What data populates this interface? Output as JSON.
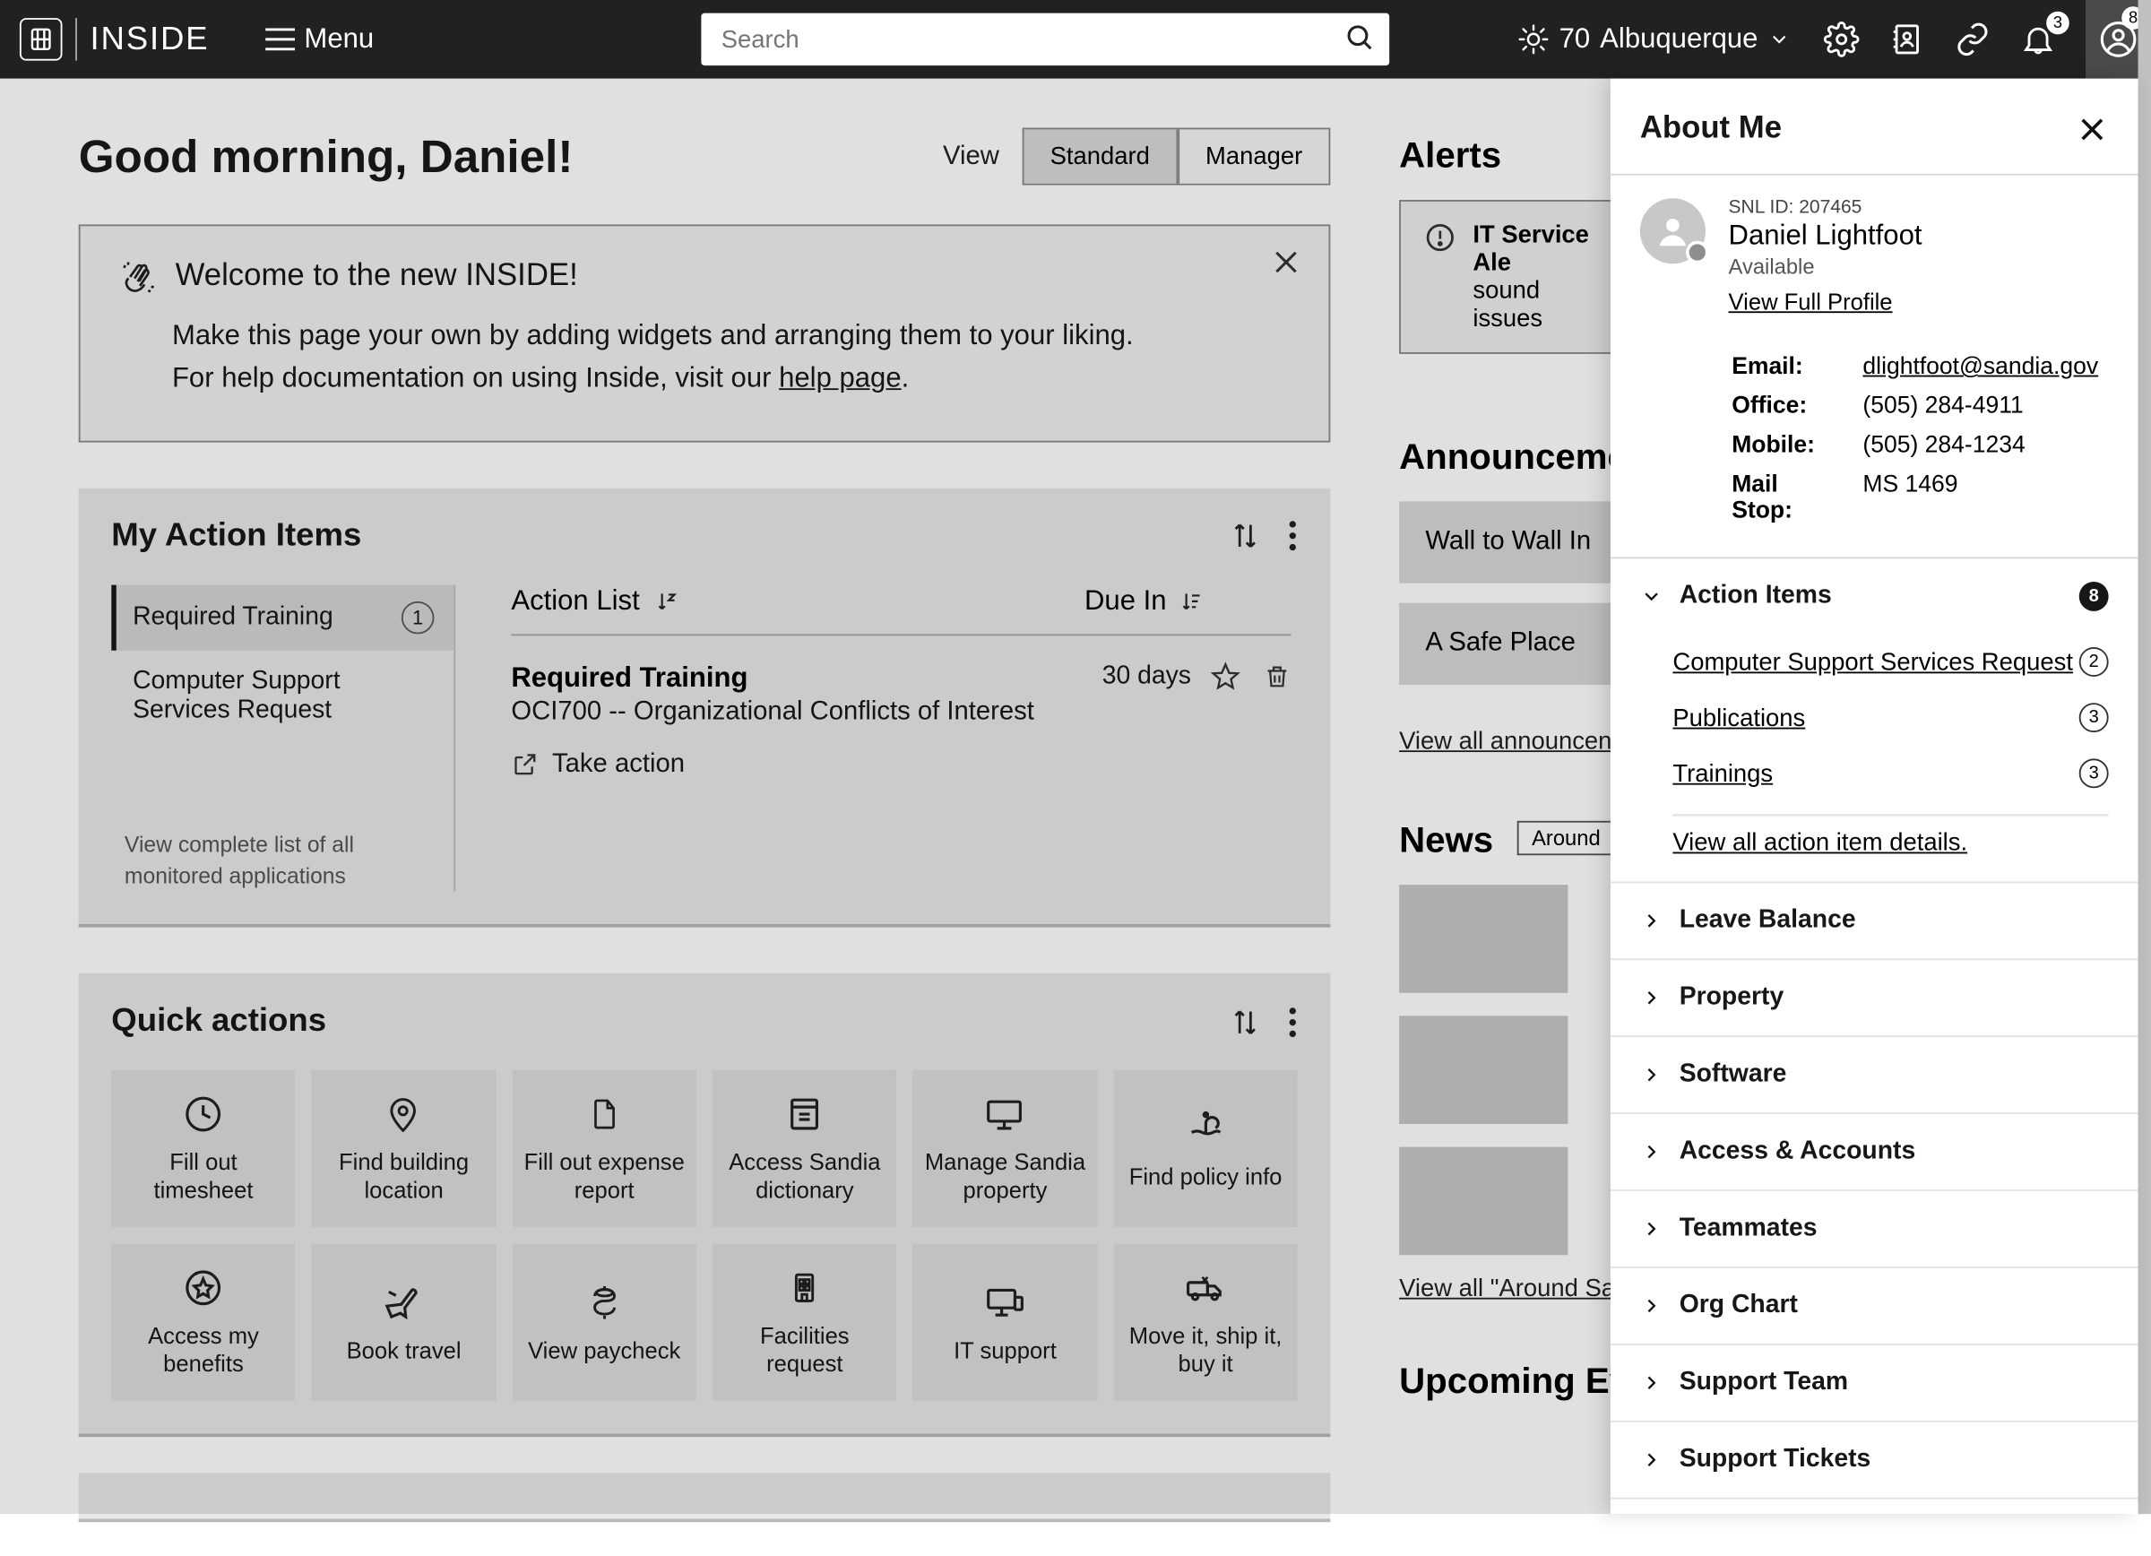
{
  "brand": "INSIDE",
  "menu_label": "Menu",
  "search_placeholder": "Search",
  "weather": {
    "temp": "70",
    "city": "Albuquerque"
  },
  "notif_badge": "3",
  "profile_badge": "8",
  "greeting": "Good morning, Daniel!",
  "view_label": "View",
  "view_standard": "Standard",
  "view_manager": "Manager",
  "welcome": {
    "title": "Welcome to the new INSIDE!",
    "line1": "Make this page your own by adding widgets and arranging them to your liking.",
    "line2a": "For help documentation on using Inside, visit our ",
    "line2_link": "help page",
    "line2b": "."
  },
  "action_items_panel": {
    "title": "My Action Items",
    "tab_required": "Required Training",
    "tab_required_count": "1",
    "tab_cssr": "Computer Support Services Request",
    "foot": "View complete list of all monitored applications",
    "col_action": "Action List",
    "col_due": "Due In",
    "item_title": "Required Training",
    "item_sub": "OCI700 -- Organizational Conflicts of Interest",
    "item_due": "30 days",
    "take_action": "Take action"
  },
  "quick_actions": {
    "title": "Quick actions",
    "tiles": [
      "Fill out timesheet",
      "Find building location",
      "Fill out expense report",
      "Access Sandia dictionary",
      "Manage Sandia property",
      "Find policy info",
      "Access my benefits",
      "Book travel",
      "View paycheck",
      "Facilities request",
      "IT support",
      "Move it, ship it, buy it"
    ]
  },
  "alerts": {
    "title": "Alerts",
    "item_line1": "IT Service Ale",
    "item_line2": "sound issues"
  },
  "announcements": {
    "title": "Announcemen",
    "item1": "Wall to Wall In",
    "item2": "A Safe Place",
    "view_all": "View all announcen"
  },
  "news": {
    "title": "News",
    "tag": "Around",
    "view_all": "View all \"Around Sa"
  },
  "upcoming_title": "Upcoming Ev",
  "about": {
    "title": "About Me",
    "snl_id": "SNL ID: 207465",
    "name": "Daniel Lightfoot",
    "status": "Available",
    "view_profile": "View Full Profile",
    "email_k": "Email:",
    "email_v": "dlightfoot@sandia.gov",
    "office_k": "Office:",
    "office_v": "(505) 284-4911",
    "mobile_k": "Mobile:",
    "mobile_v": "(505) 284-1234",
    "mailstop_k": "Mail Stop:",
    "mailstop_v": "MS 1469",
    "acc_action_items": "Action Items",
    "acc_action_items_badge": "8",
    "ai_cssr": "Computer Support Services Request",
    "ai_cssr_b": "2",
    "ai_pubs": "Publications",
    "ai_pubs_b": "3",
    "ai_train": "Trainings",
    "ai_train_b": "3",
    "ai_viewall": "View all action item details",
    "acc_leave": "Leave Balance",
    "acc_property": "Property",
    "acc_software": "Software",
    "acc_access": "Access & Accounts",
    "acc_team": "Teammates",
    "acc_org": "Org Chart",
    "acc_support_team": "Support Team",
    "acc_tickets": "Support Tickets"
  }
}
